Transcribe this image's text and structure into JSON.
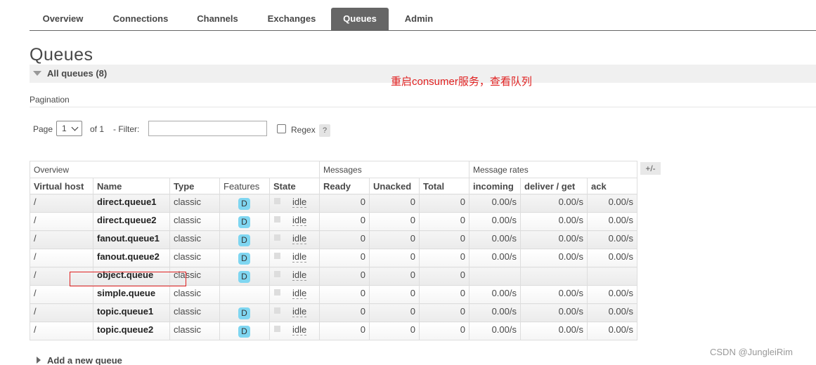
{
  "nav": {
    "tabs": [
      {
        "label": "Overview",
        "active": false
      },
      {
        "label": "Connections",
        "active": false
      },
      {
        "label": "Channels",
        "active": false
      },
      {
        "label": "Exchanges",
        "active": false
      },
      {
        "label": "Queues",
        "active": true
      },
      {
        "label": "Admin",
        "active": false
      }
    ]
  },
  "page_title": "Queues",
  "section": {
    "label": "All queues (8)",
    "icon": "collapse-triangle-icon"
  },
  "annotation": "重启consumer服务，查看队列",
  "pagination": {
    "label": "Pagination",
    "page_label": "Page",
    "page_value": "1",
    "of_label": "of 1",
    "filter_label": "- Filter:",
    "filter_value": "",
    "regex_label": "Regex",
    "regex_checked": false,
    "help_label": "?"
  },
  "table": {
    "groups": [
      "Overview",
      "Messages",
      "Message rates"
    ],
    "plus_minus": "+/-",
    "columns": [
      "Virtual host",
      "Name",
      "Type",
      "Features",
      "State",
      "Ready",
      "Unacked",
      "Total",
      "incoming",
      "deliver / get",
      "ack"
    ],
    "rows": [
      {
        "vhost": "/",
        "name": "direct.queue1",
        "type": "classic",
        "feature": "D",
        "state": "idle",
        "ready": "0",
        "unacked": "0",
        "total": "0",
        "incoming": "0.00/s",
        "deliver": "0.00/s",
        "ack": "0.00/s"
      },
      {
        "vhost": "/",
        "name": "direct.queue2",
        "type": "classic",
        "feature": "D",
        "state": "idle",
        "ready": "0",
        "unacked": "0",
        "total": "0",
        "incoming": "0.00/s",
        "deliver": "0.00/s",
        "ack": "0.00/s"
      },
      {
        "vhost": "/",
        "name": "fanout.queue1",
        "type": "classic",
        "feature": "D",
        "state": "idle",
        "ready": "0",
        "unacked": "0",
        "total": "0",
        "incoming": "0.00/s",
        "deliver": "0.00/s",
        "ack": "0.00/s"
      },
      {
        "vhost": "/",
        "name": "fanout.queue2",
        "type": "classic",
        "feature": "D",
        "state": "idle",
        "ready": "0",
        "unacked": "0",
        "total": "0",
        "incoming": "0.00/s",
        "deliver": "0.00/s",
        "ack": "0.00/s"
      },
      {
        "vhost": "/",
        "name": "object.queue",
        "type": "classic",
        "feature": "D",
        "state": "idle",
        "ready": "0",
        "unacked": "0",
        "total": "0",
        "incoming": "",
        "deliver": "",
        "ack": ""
      },
      {
        "vhost": "/",
        "name": "simple.queue",
        "type": "classic",
        "feature": "",
        "state": "idle",
        "ready": "0",
        "unacked": "0",
        "total": "0",
        "incoming": "0.00/s",
        "deliver": "0.00/s",
        "ack": "0.00/s"
      },
      {
        "vhost": "/",
        "name": "topic.queue1",
        "type": "classic",
        "feature": "D",
        "state": "idle",
        "ready": "0",
        "unacked": "0",
        "total": "0",
        "incoming": "0.00/s",
        "deliver": "0.00/s",
        "ack": "0.00/s"
      },
      {
        "vhost": "/",
        "name": "topic.queue2",
        "type": "classic",
        "feature": "D",
        "state": "idle",
        "ready": "0",
        "unacked": "0",
        "total": "0",
        "incoming": "0.00/s",
        "deliver": "0.00/s",
        "ack": "0.00/s"
      }
    ]
  },
  "add_queue": {
    "label": "Add a new queue",
    "icon": "expand-triangle-icon"
  },
  "watermark": "CSDN @JungleiRim",
  "colors": {
    "active_tab": "#666666",
    "durable_badge": "#7fd6f1",
    "annotation": "#e02020"
  }
}
